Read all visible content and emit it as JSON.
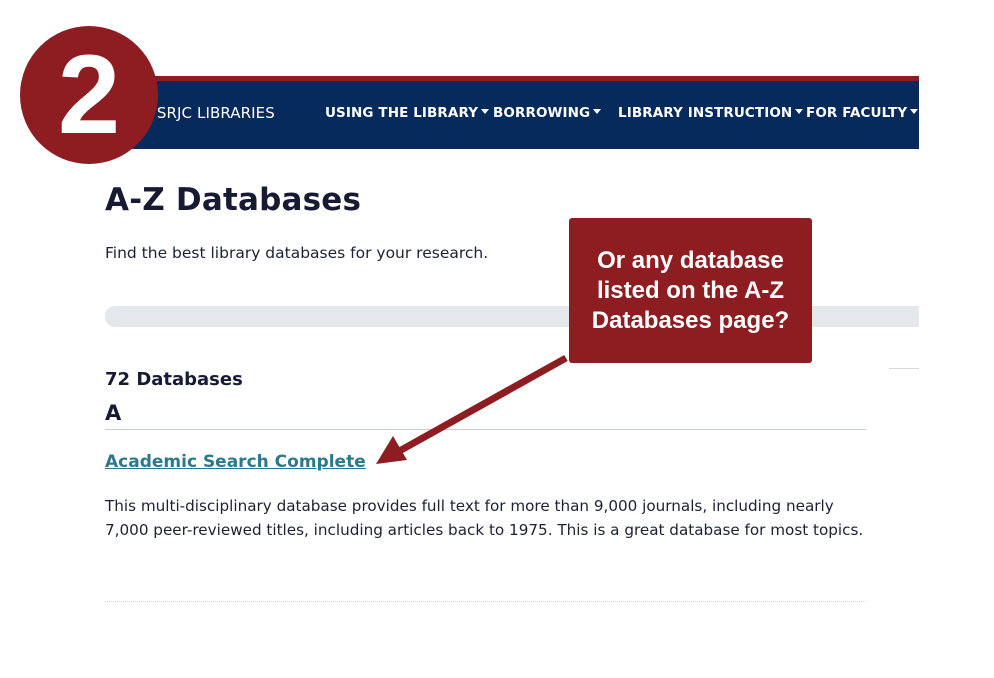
{
  "step_badge": {
    "number": "2"
  },
  "navbar": {
    "brand": "SRJC LIBRARIES",
    "items": [
      {
        "label": "USING THE LIBRARY"
      },
      {
        "label": "BORROWING"
      },
      {
        "label": "LIBRARY INSTRUCTION"
      },
      {
        "label": "FOR FACULTY"
      }
    ]
  },
  "page": {
    "title": "A-Z Databases",
    "subtitle": "Find the best library databases for your research."
  },
  "results": {
    "count": "72 Databases",
    "letter": "A",
    "databases": [
      {
        "name": "Academic Search Complete",
        "description": "This multi-disciplinary database provides full text for more than 9,000 journals, including nearly 7,000 peer-reviewed titles, including articles back to 1975. This is a great database for most topics."
      }
    ]
  },
  "callout": {
    "text": "Or any database listed on the A-Z Databases page?"
  },
  "colors": {
    "navbar": "#062a5b",
    "accent_red": "#8e1d22",
    "link": "#2b7a8c",
    "search_bar": "#e4e7eb"
  },
  "icons": {
    "arrow": "arrow-pointer-icon"
  }
}
